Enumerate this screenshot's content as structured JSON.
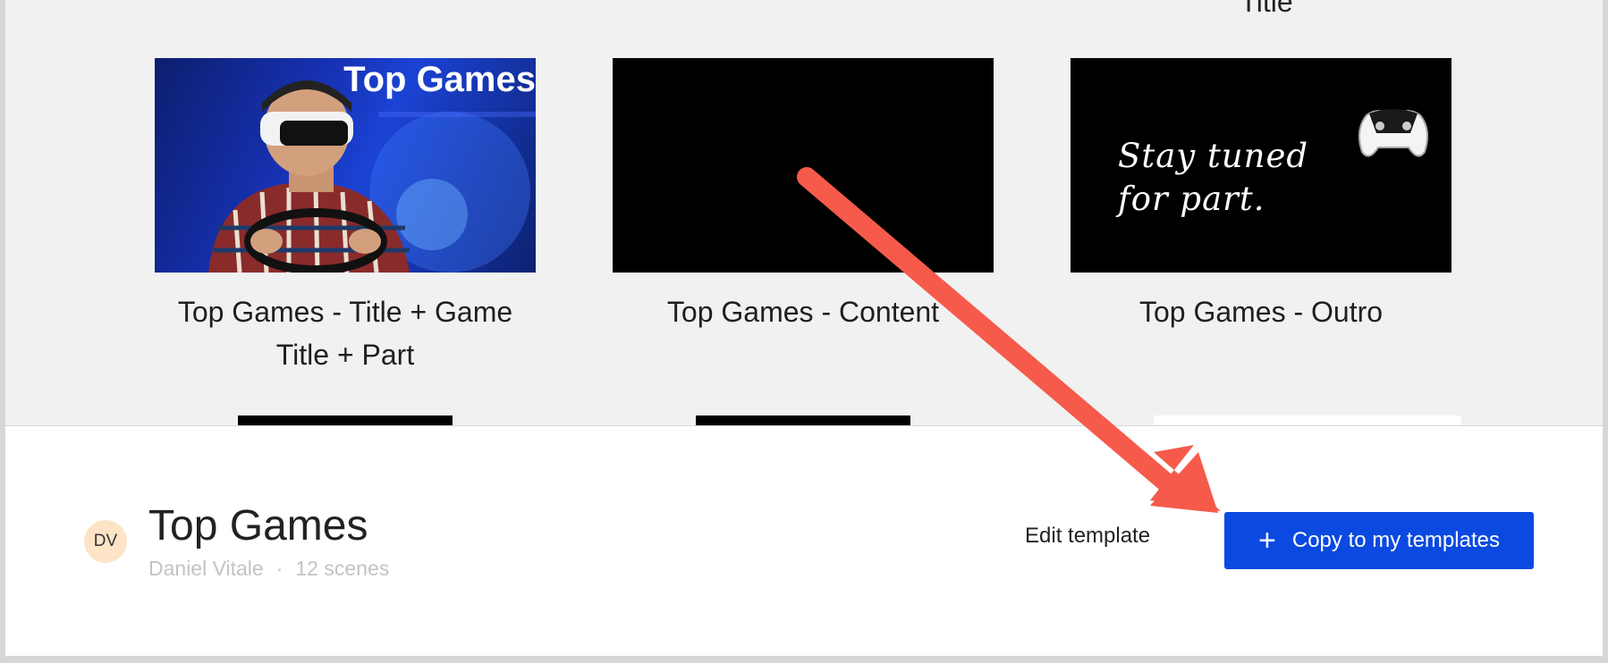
{
  "gallery": {
    "partial_caption_above": "Title",
    "cards": [
      {
        "caption": "Top Games - Title + Game Title + Part",
        "overlay_text": "Top Games"
      },
      {
        "caption": "Top Games - Content"
      },
      {
        "caption": "Top Games - Outro",
        "overlay_text": "Stay tuned for part."
      }
    ]
  },
  "template": {
    "avatar_initials": "DV",
    "title": "Top Games",
    "author": "Daniel Vitale",
    "separator": "·",
    "scene_count": "12 scenes"
  },
  "actions": {
    "edit_label": "Edit template",
    "copy_label": "Copy to my templates"
  },
  "colors": {
    "primary": "#0b49e0",
    "annotation_arrow": "#f65a4a",
    "avatar_bg": "#fde4c6"
  }
}
